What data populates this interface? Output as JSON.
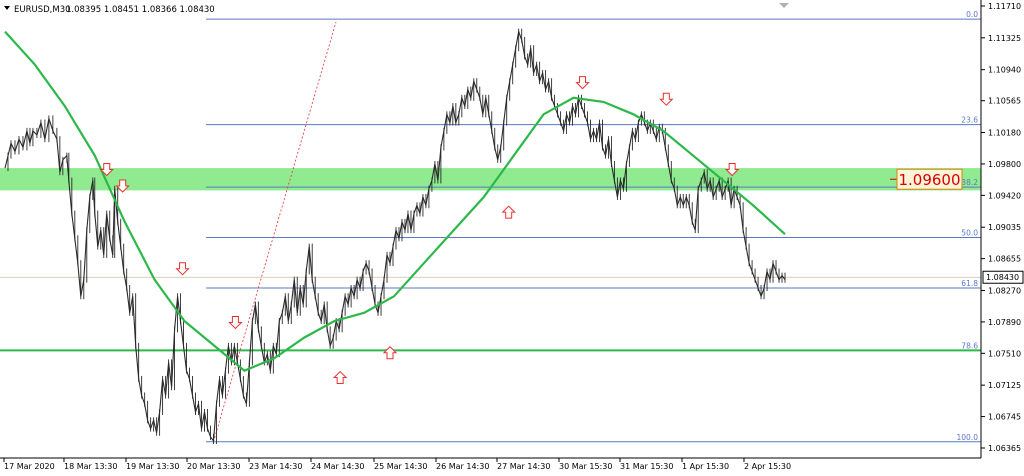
{
  "header": {
    "symbol": "EURUSD,M30",
    "ohlc": "1.08395 1.08451 1.08366 1.08430"
  },
  "chart_data": {
    "type": "line",
    "title": "",
    "y_ticks": [
      "1.11710",
      "1.11325",
      "1.10940",
      "1.10565",
      "1.10180",
      "1.09800",
      "1.09420",
      "1.09035",
      "1.08655",
      "1.08270",
      "1.07890",
      "1.07510",
      "1.07125",
      "1.06745",
      "1.06365"
    ],
    "x_ticks": [
      "17 Mar 2020",
      "18 Mar 13:30",
      "19 Mar 13:30",
      "20 Mar 13:30",
      "23 Mar 14:30",
      "24 Mar 14:30",
      "25 Mar 14:30",
      "26 Mar 14:30",
      "27 Mar 14:30",
      "30 Mar 15:30",
      "31 Mar 15:30",
      "1 Apr 15:30",
      "2 Apr 15:30"
    ],
    "price": [
      [
        0,
        1.0975
      ],
      [
        3,
        1.099
      ],
      [
        6,
        1.1005
      ],
      [
        10,
        1.0995
      ],
      [
        14,
        1.101
      ],
      [
        18,
        1.1
      ],
      [
        22,
        1.102
      ],
      [
        25,
        1.1005
      ],
      [
        28,
        1.102
      ],
      [
        32,
        1.1015
      ],
      [
        36,
        1.103
      ],
      [
        40,
        1.101
      ],
      [
        44,
        1.1035
      ],
      [
        48,
        1.102
      ],
      [
        52,
        1.101
      ],
      [
        55,
        1.097
      ],
      [
        58,
        1.0985
      ],
      [
        62,
        1.099
      ],
      [
        64,
        1.096
      ],
      [
        67,
        1.092
      ],
      [
        70,
        1.089
      ],
      [
        73,
        1.086
      ],
      [
        76,
        1.082
      ],
      [
        79,
        1.084
      ],
      [
        82,
        1.09
      ],
      [
        85,
        1.094
      ],
      [
        88,
        1.096
      ],
      [
        90,
        1.092
      ],
      [
        93,
        1.088
      ],
      [
        96,
        1.09
      ],
      [
        99,
        1.087
      ],
      [
        102,
        1.092
      ],
      [
        105,
        1.089
      ],
      [
        108,
        1.087
      ],
      [
        110,
        1.095
      ],
      [
        113,
        1.091
      ],
      [
        116,
        1.088
      ],
      [
        119,
        1.085
      ],
      [
        122,
        1.083
      ],
      [
        125,
        1.08
      ],
      [
        128,
        1.082
      ],
      [
        131,
        1.076
      ],
      [
        134,
        1.072
      ],
      [
        137,
        1.07
      ],
      [
        140,
        1.069
      ],
      [
        143,
        1.067
      ],
      [
        146,
        1.066
      ],
      [
        149,
        1.067
      ],
      [
        152,
        1.0655
      ],
      [
        155,
        1.068
      ],
      [
        158,
        1.072
      ],
      [
        161,
        1.07
      ],
      [
        164,
        1.074
      ],
      [
        167,
        1.071
      ],
      [
        170,
        1.078
      ],
      [
        173,
        1.082
      ],
      [
        176,
        1.079
      ],
      [
        179,
        1.076
      ],
      [
        182,
        1.073
      ],
      [
        185,
        1.072
      ],
      [
        188,
        1.07
      ],
      [
        191,
        1.068
      ],
      [
        194,
        1.069
      ],
      [
        197,
        1.066
      ],
      [
        200,
        1.068
      ],
      [
        203,
        1.066
      ],
      [
        206,
        1.065
      ],
      [
        209,
        1.0645
      ],
      [
        212,
        1.069
      ],
      [
        215,
        1.072
      ],
      [
        218,
        1.07
      ],
      [
        221,
        1.073
      ],
      [
        224,
        1.076
      ],
      [
        227,
        1.074
      ],
      [
        230,
        1.076
      ],
      [
        233,
        1.074
      ],
      [
        236,
        1.072
      ],
      [
        239,
        1.07
      ],
      [
        242,
        1.069
      ],
      [
        245,
        1.074
      ],
      [
        248,
        1.079
      ],
      [
        251,
        1.081
      ],
      [
        254,
        1.078
      ],
      [
        257,
        1.076
      ],
      [
        260,
        1.074
      ],
      [
        263,
        1.075
      ],
      [
        266,
        1.073
      ],
      [
        269,
        1.076
      ],
      [
        272,
        1.075
      ],
      [
        275,
        1.079
      ],
      [
        278,
        1.08
      ],
      [
        281,
        1.082
      ],
      [
        284,
        1.079
      ],
      [
        287,
        1.081
      ],
      [
        290,
        1.084
      ],
      [
        293,
        1.08
      ],
      [
        296,
        1.083
      ],
      [
        299,
        1.081
      ],
      [
        302,
        1.085
      ],
      [
        305,
        1.088
      ],
      [
        308,
        1.084
      ],
      [
        311,
        1.082
      ],
      [
        314,
        1.08
      ],
      [
        317,
        1.079
      ],
      [
        320,
        1.081
      ],
      [
        323,
        1.078
      ],
      [
        326,
        1.076
      ],
      [
        329,
        1.077
      ],
      [
        332,
        1.079
      ],
      [
        335,
        1.078
      ],
      [
        338,
        1.08
      ],
      [
        341,
        1.082
      ],
      [
        344,
        1.081
      ],
      [
        347,
        1.083
      ],
      [
        350,
        1.082
      ],
      [
        353,
        1.084
      ],
      [
        356,
        1.083
      ],
      [
        359,
        1.085
      ],
      [
        362,
        1.086
      ],
      [
        365,
        1.085
      ],
      [
        368,
        1.083
      ],
      [
        371,
        1.081
      ],
      [
        374,
        1.08
      ],
      [
        377,
        1.082
      ],
      [
        380,
        1.084
      ],
      [
        383,
        1.087
      ],
      [
        386,
        1.086
      ],
      [
        389,
        1.088
      ],
      [
        392,
        1.09
      ],
      [
        395,
        1.089
      ],
      [
        398,
        1.091
      ],
      [
        401,
        1.09
      ],
      [
        404,
        1.092
      ],
      [
        407,
        1.09
      ],
      [
        410,
        1.092
      ],
      [
        413,
        1.093
      ],
      [
        416,
        1.092
      ],
      [
        419,
        1.094
      ],
      [
        422,
        1.093
      ],
      [
        425,
        1.095
      ],
      [
        428,
        1.096
      ],
      [
        431,
        1.098
      ],
      [
        434,
        1.096
      ],
      [
        437,
        1.1
      ],
      [
        440,
        1.102
      ],
      [
        443,
        1.104
      ],
      [
        446,
        1.103
      ],
      [
        449,
        1.105
      ],
      [
        452,
        1.103
      ],
      [
        455,
        1.104
      ],
      [
        458,
        1.106
      ],
      [
        461,
        1.105
      ],
      [
        464,
        1.107
      ],
      [
        467,
        1.106
      ],
      [
        470,
        1.108
      ],
      [
        473,
        1.107
      ],
      [
        476,
        1.106
      ],
      [
        479,
        1.104
      ],
      [
        482,
        1.106
      ],
      [
        485,
        1.104
      ],
      [
        488,
        1.102
      ],
      [
        491,
        1.1
      ],
      [
        494,
        1.0985
      ],
      [
        497,
        1.1
      ],
      [
        500,
        1.103
      ],
      [
        503,
        1.106
      ],
      [
        506,
        1.108
      ],
      [
        509,
        1.11
      ],
      [
        512,
        1.112
      ],
      [
        515,
        1.114
      ],
      [
        518,
        1.113
      ],
      [
        521,
        1.111
      ],
      [
        524,
        1.11
      ],
      [
        527,
        1.112
      ],
      [
        530,
        1.109
      ],
      [
        533,
        1.11
      ],
      [
        536,
        1.108
      ],
      [
        539,
        1.109
      ],
      [
        542,
        1.107
      ],
      [
        545,
        1.108
      ],
      [
        548,
        1.106
      ],
      [
        551,
        1.105
      ],
      [
        554,
        1.104
      ],
      [
        557,
        1.103
      ],
      [
        560,
        1.102
      ],
      [
        563,
        1.104
      ],
      [
        566,
        1.103
      ],
      [
        569,
        1.105
      ],
      [
        572,
        1.104
      ],
      [
        575,
        1.106
      ],
      [
        578,
        1.105
      ],
      [
        581,
        1.104
      ],
      [
        584,
        1.103
      ],
      [
        587,
        1.101
      ],
      [
        590,
        1.102
      ],
      [
        593,
        1.101
      ],
      [
        596,
        1.103
      ],
      [
        599,
        1.1
      ],
      [
        602,
        1.099
      ],
      [
        605,
        1.101
      ],
      [
        608,
        1.098
      ],
      [
        611,
        1.096
      ],
      [
        614,
        1.094
      ],
      [
        617,
        1.096
      ],
      [
        620,
        1.095
      ],
      [
        623,
        1.098
      ],
      [
        626,
        1.1
      ],
      [
        629,
        1.102
      ],
      [
        632,
        1.101
      ],
      [
        635,
        1.103
      ],
      [
        638,
        1.104
      ],
      [
        641,
        1.103
      ],
      [
        644,
        1.102
      ],
      [
        647,
        1.103
      ],
      [
        650,
        1.102
      ],
      [
        653,
        1.101
      ],
      [
        656,
        1.1025
      ],
      [
        659,
        1.102
      ],
      [
        662,
        1.1
      ],
      [
        665,
        1.098
      ],
      [
        668,
        1.096
      ],
      [
        671,
        1.095
      ],
      [
        674,
        1.093
      ],
      [
        677,
        1.094
      ],
      [
        680,
        1.093
      ],
      [
        683,
        1.094
      ],
      [
        686,
        1.093
      ],
      [
        689,
        1.091
      ],
      [
        692,
        1.09
      ],
      [
        695,
        1.095
      ],
      [
        698,
        1.096
      ],
      [
        701,
        1.097
      ],
      [
        704,
        1.095
      ],
      [
        707,
        1.096
      ],
      [
        710,
        1.094
      ],
      [
        713,
        1.095
      ],
      [
        716,
        1.096
      ],
      [
        719,
        1.094
      ],
      [
        722,
        1.095
      ],
      [
        725,
        1.096
      ],
      [
        728,
        1.093
      ],
      [
        731,
        1.095
      ],
      [
        734,
        1.094
      ],
      [
        737,
        1.093
      ],
      [
        740,
        1.09
      ],
      [
        743,
        1.088
      ],
      [
        746,
        1.086
      ],
      [
        749,
        1.085
      ],
      [
        752,
        1.084
      ],
      [
        755,
        1.083
      ],
      [
        758,
        1.082
      ],
      [
        761,
        1.083
      ],
      [
        764,
        1.085
      ],
      [
        767,
        1.084
      ],
      [
        770,
        1.086
      ],
      [
        773,
        1.085
      ],
      [
        776,
        1.084
      ],
      [
        779,
        1.0845
      ],
      [
        782,
        1.084
      ]
    ],
    "moving_average": [
      [
        0,
        1.114
      ],
      [
        30,
        1.11
      ],
      [
        60,
        1.105
      ],
      [
        90,
        1.099
      ],
      [
        120,
        1.091
      ],
      [
        150,
        1.084
      ],
      [
        180,
        1.079
      ],
      [
        210,
        1.076
      ],
      [
        240,
        1.073
      ],
      [
        270,
        1.0745
      ],
      [
        300,
        1.077
      ],
      [
        330,
        1.079
      ],
      [
        360,
        1.08
      ],
      [
        390,
        1.082
      ],
      [
        420,
        1.086
      ],
      [
        450,
        1.09
      ],
      [
        480,
        1.094
      ],
      [
        510,
        1.099
      ],
      [
        540,
        1.104
      ],
      [
        570,
        1.106
      ],
      [
        600,
        1.1055
      ],
      [
        630,
        1.104
      ],
      [
        660,
        1.102
      ],
      [
        690,
        1.099
      ],
      [
        720,
        1.096
      ],
      [
        750,
        1.093
      ],
      [
        782,
        1.0895
      ]
    ],
    "fibonacci": [
      {
        "label": "0.0",
        "price": 1.11551
      },
      {
        "label": "23.6",
        "price": 1.10276
      },
      {
        "label": "38.2",
        "price": 1.0952
      },
      {
        "label": "50.0",
        "price": 1.0891
      },
      {
        "label": "61.8",
        "price": 1.083
      },
      {
        "label": "78.6",
        "price": 1.07545
      },
      {
        "label": "100.0",
        "price": 1.0644
      }
    ],
    "zone": {
      "from": 1.0948,
      "to": 1.0975,
      "label": "1.09600"
    },
    "current_price": "1.08430",
    "arrows_down": [
      [
        102,
        1.096
      ],
      [
        118,
        1.094
      ],
      [
        178,
        1.084
      ],
      [
        231,
        1.0775
      ],
      [
        579,
        1.1065
      ],
      [
        663,
        1.1045
      ],
      [
        729,
        1.096
      ]
    ],
    "arrows_up": [
      [
        336,
        1.0735
      ],
      [
        386,
        1.0765
      ],
      [
        505,
        1.0935
      ]
    ],
    "colors": {
      "candles": "#2a2a2a",
      "ma": "#2db84a",
      "fib": "#5b78c7",
      "zone": "#7ce87c",
      "label_border": "#d48400",
      "label_text": "#d40000",
      "arrow": "#e83030"
    }
  }
}
